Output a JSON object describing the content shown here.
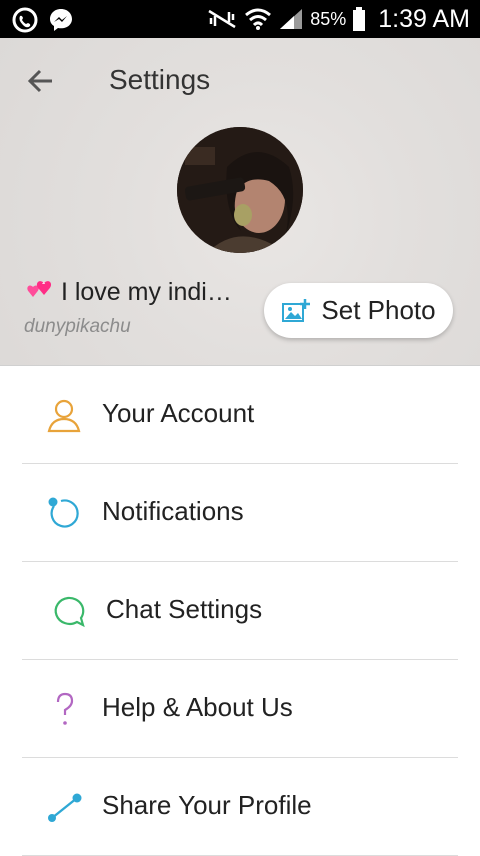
{
  "status_bar": {
    "battery": "85%",
    "time": "1:39 AM",
    "icons": [
      "phone-wifi-icon",
      "messenger-icon",
      "no-signal-icon",
      "wifi-icon",
      "cell-signal-icon",
      "battery-icon"
    ]
  },
  "header": {
    "title": "Settings",
    "status_text": "I love my indi…",
    "username": "dunypikachu",
    "set_photo_label": "Set Photo"
  },
  "menu": {
    "items": [
      {
        "label": "Your Account",
        "icon": "person-icon",
        "color": "#e8a33a"
      },
      {
        "label": "Notifications",
        "icon": "notification-ring-icon",
        "color": "#2fa8d5"
      },
      {
        "label": "Chat Settings",
        "icon": "chat-bubble-icon",
        "color": "#3ab86a"
      },
      {
        "label": "Help & About Us",
        "icon": "question-icon",
        "color": "#b267c2"
      },
      {
        "label": "Share Your Profile",
        "icon": "share-icon",
        "color": "#2fa8d5"
      }
    ]
  },
  "colors": {
    "accent_blue": "#2fa8d5",
    "header_bg": "#e2dfdd"
  }
}
